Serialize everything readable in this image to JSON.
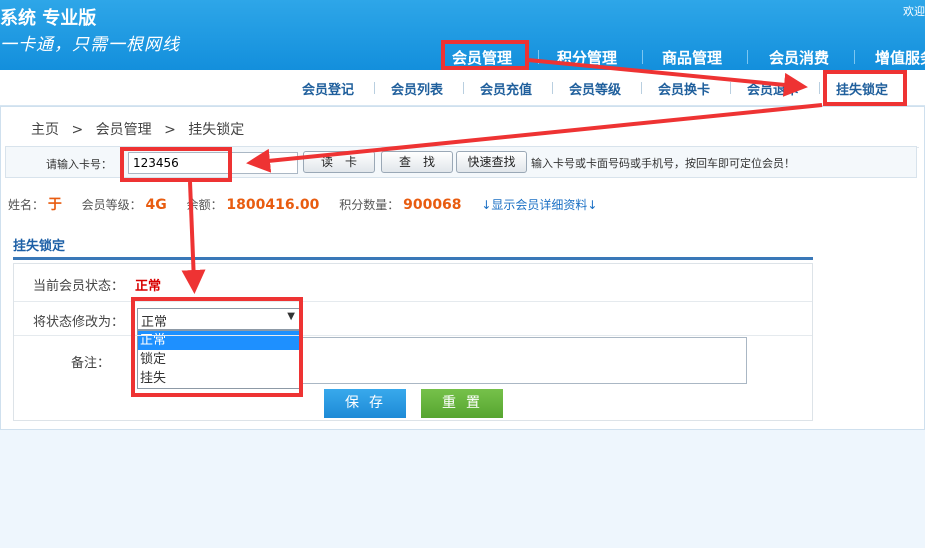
{
  "header": {
    "title": "系统 专业版",
    "slogan": "一卡通，只需一根网线",
    "welcome": "欢迎",
    "nav": [
      "会员管理",
      "积分管理",
      "商品管理",
      "会员消费",
      "增值服务"
    ]
  },
  "subnav": [
    "会员登记",
    "会员列表",
    "会员充值",
    "会员等级",
    "会员换卡",
    "会员退卡",
    "挂失锁定"
  ],
  "breadcrumb": [
    "主页",
    ">",
    "会员管理",
    ">",
    "挂失锁定"
  ],
  "search": {
    "label": "请输入卡号：",
    "value": "123456",
    "read_card_button": "读　卡",
    "find_button": "查　找",
    "quick_find_button": "快速查找",
    "hint": "输入卡号或卡面号码或手机号，按回车即可定位会员！"
  },
  "member": {
    "name_label": "姓名：",
    "name": "于",
    "level_label": "会员等级：",
    "level": "4G",
    "balance_label": "余额：",
    "balance": "1800416.00",
    "points_label": "积分数量：",
    "points": "900068",
    "details_link": "↓显示会员详细资料↓"
  },
  "form": {
    "section_title": "挂失锁定",
    "status_label": "当前会员状态：",
    "status_value": "正常",
    "change_label": "将状态修改为：",
    "selected": "正常",
    "options": [
      "正常",
      "锁定",
      "挂失"
    ],
    "remark_label": "备注：",
    "save_button": "保存",
    "reset_button": "重置"
  },
  "colors": {
    "header_blue": "#1a95de",
    "annotation_red": "#ee3333",
    "save_blue": "#2a9be2",
    "reset_green": "#64b23c",
    "status_red": "#d80000",
    "value_orange": "#e85c10"
  }
}
